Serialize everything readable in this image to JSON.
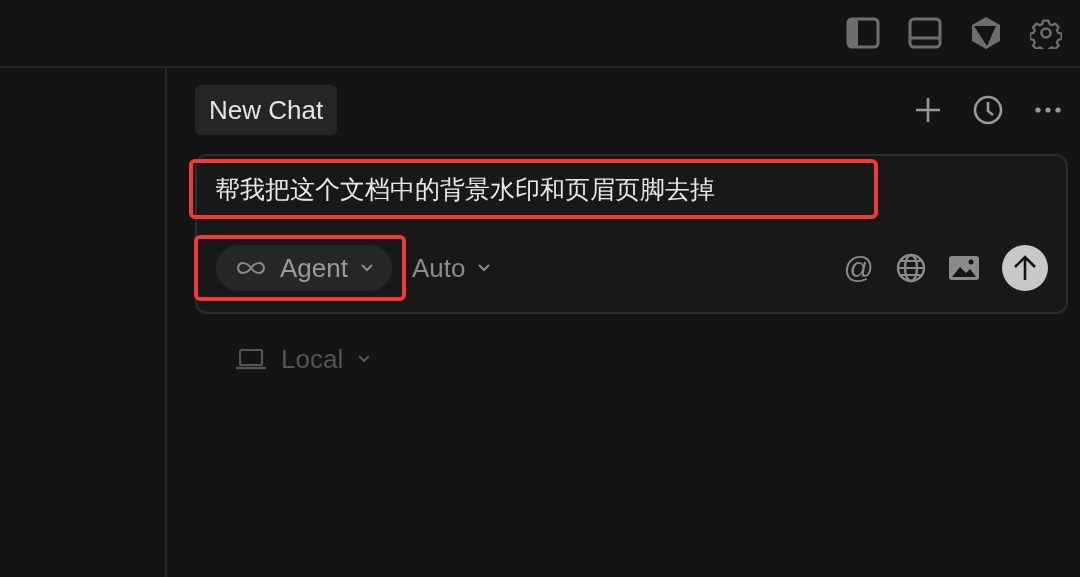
{
  "tabs": [
    {
      "label": "New Chat",
      "selected": true
    }
  ],
  "composer": {
    "message": {
      "text": "帮我把这个文档中的背景水印和页眉页脚去掉",
      "highlighted": true
    },
    "mode": {
      "label": "Agent",
      "highlighted": true
    },
    "model": {
      "label": "Auto"
    },
    "mention": "@"
  },
  "environment": {
    "label": "Local"
  }
}
